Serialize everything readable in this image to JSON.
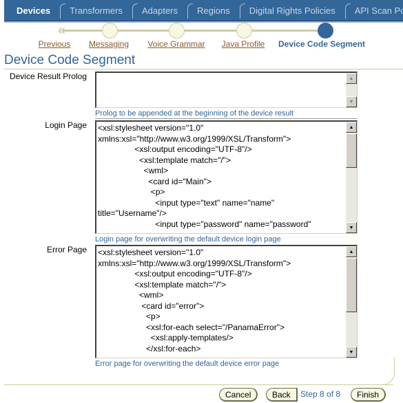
{
  "tabs": [
    {
      "label": "Devices",
      "active": true
    },
    {
      "label": "Transformers",
      "active": false
    },
    {
      "label": "Adapters",
      "active": false
    },
    {
      "label": "Regions",
      "active": false
    },
    {
      "label": "Digital Rights Policies",
      "active": false
    },
    {
      "label": "API Scan Po",
      "active": false
    }
  ],
  "train": {
    "previous_label": "Previous",
    "steps": [
      {
        "label": "Messaging",
        "state": "visited"
      },
      {
        "label": "Voice Grammar",
        "state": "visited"
      },
      {
        "label": "Java Profile",
        "state": "visited"
      },
      {
        "label": "Device Code Segment",
        "state": "current"
      }
    ]
  },
  "page": {
    "title": "Device Code Segment"
  },
  "fields": {
    "prolog": {
      "label": "Device Result Prolog",
      "value": "",
      "hint": "Prolog to be appended at the beginning of the device result"
    },
    "login": {
      "label": "Login Page",
      "value": "<xsl:stylesheet version=\"1.0\"\nxmlns:xsl=\"http://www.w3.org/1999/XSL/Transform\">\n                <xsl:output encoding=\"UTF-8\"/>\n                  <xsl:template match=\"/\">\n                    <wml>\n                      <card id=\"Main\">\n                       <p>\n                         <input type=\"text\" name=\"name\"\ntitle=\"Username\"/>\n                         <input type=\"password\" name=\"password\"",
      "hint": "Login page for overwriting the default device login page"
    },
    "error": {
      "label": "Error Page",
      "value": "<xsl:stylesheet version=\"1.0\"\nxmlns:xsl=\"http://www.w3.org/1999/XSL/Transform\">\n                <xsl:output encoding=\"UTF-8\"/>\n                <xsl:template match=\"/\">\n                  <wml>\n                   <card id=\"error\">\n                     <p>\n                     <xsl:for-each select=\"/PanamaError\">\n                       <xsl:apply-templates/>\n                     </xsl:for-each>",
      "hint": "Error page for overwriting the default device error page"
    }
  },
  "footer": {
    "cancel_label": "Cancel",
    "back_label": "Back",
    "step_text": "Step 8 of 8",
    "finish_label": "Finish"
  },
  "icons": {
    "previous": "«",
    "scroll_up": "▲",
    "scroll_down": "▼"
  },
  "colors": {
    "brand": "#336699",
    "train_line": "#cfcd9f",
    "link": "#8b5a2b"
  }
}
